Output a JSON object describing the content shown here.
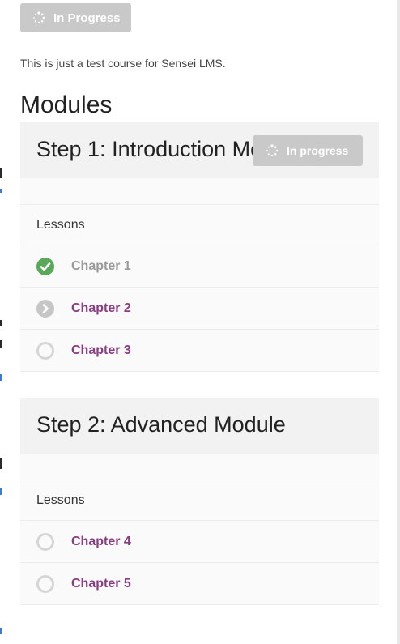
{
  "course_status": {
    "label": "In Progress",
    "icon": "spinner-icon"
  },
  "course_description": "This is just a test course for Sensei LMS.",
  "modules_heading": "Modules",
  "modules": [
    {
      "title": "Step 1: Introduction Module",
      "status": {
        "label": "In progress",
        "icon": "spinner-icon"
      },
      "lessons_label": "Lessons",
      "lessons": [
        {
          "title": "Chapter 1",
          "state": "completed",
          "icon": "check-circle-icon"
        },
        {
          "title": "Chapter 2",
          "state": "in-progress",
          "icon": "arrow-circle-icon"
        },
        {
          "title": "Chapter 3",
          "state": "not-started",
          "icon": "empty-circle-icon"
        }
      ]
    },
    {
      "title": "Step 2: Advanced Module",
      "lessons_label": "Lessons",
      "lessons": [
        {
          "title": "Chapter 4",
          "state": "not-started",
          "icon": "empty-circle-icon"
        },
        {
          "title": "Chapter 5",
          "state": "not-started",
          "icon": "empty-circle-icon"
        }
      ]
    }
  ],
  "colors": {
    "badge_bg": "#c9c9c9",
    "completed_green": "#5aa85a",
    "link_purple": "#8a3c82",
    "done_text_gray": "#9a9a9a"
  }
}
